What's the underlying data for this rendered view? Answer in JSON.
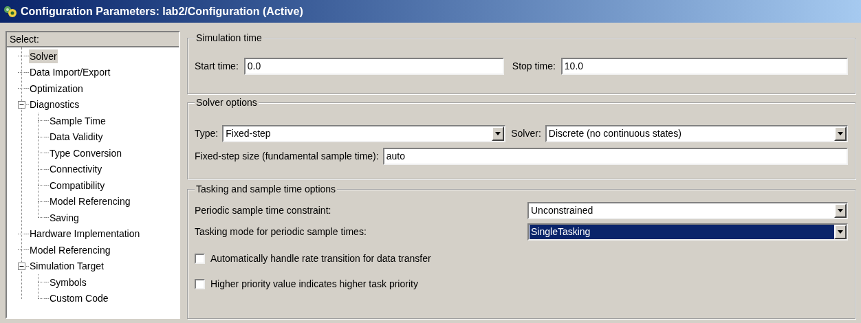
{
  "window": {
    "title": "Configuration Parameters: lab2/Configuration (Active)"
  },
  "sidebar": {
    "header": "Select:",
    "items": [
      {
        "label": "Solver",
        "selected": true
      },
      {
        "label": "Data Import/Export",
        "selected": false
      },
      {
        "label": "Optimization",
        "selected": false
      },
      {
        "label": "Diagnostics",
        "selected": false,
        "expanded": true,
        "children": [
          {
            "label": "Sample Time",
            "selected": false
          },
          {
            "label": "Data Validity",
            "selected": false
          },
          {
            "label": "Type Conversion",
            "selected": false
          },
          {
            "label": "Connectivity",
            "selected": false
          },
          {
            "label": "Compatibility",
            "selected": false
          },
          {
            "label": "Model Referencing",
            "selected": false
          },
          {
            "label": "Saving",
            "selected": false
          }
        ]
      },
      {
        "label": "Hardware Implementation",
        "selected": false
      },
      {
        "label": "Model Referencing",
        "selected": false
      },
      {
        "label": "Simulation Target",
        "selected": false,
        "expanded": true,
        "children": [
          {
            "label": "Symbols",
            "selected": false
          },
          {
            "label": "Custom Code",
            "selected": false
          }
        ]
      }
    ]
  },
  "simulation_time": {
    "title": "Simulation time",
    "start_label": "Start time:",
    "start_value": "0.0",
    "stop_label": "Stop time:",
    "stop_value": "10.0"
  },
  "solver_options": {
    "title": "Solver options",
    "type_label": "Type:",
    "type_value": "Fixed-step",
    "solver_label": "Solver:",
    "solver_value": "Discrete (no continuous states)",
    "step_label": "Fixed-step size (fundamental sample time):",
    "step_value": "auto"
  },
  "tasking": {
    "title": "Tasking and sample time options",
    "dropdowns": [
      {
        "label": "Periodic sample time constraint:",
        "value": "Unconstrained",
        "focused": false
      },
      {
        "label": "Tasking mode for periodic sample times:",
        "value": "SingleTasking",
        "focused": true
      }
    ],
    "checkboxes": [
      {
        "label": "Automatically handle rate transition for data transfer",
        "checked": false
      },
      {
        "label": "Higher priority value indicates higher task priority",
        "checked": false
      }
    ]
  }
}
